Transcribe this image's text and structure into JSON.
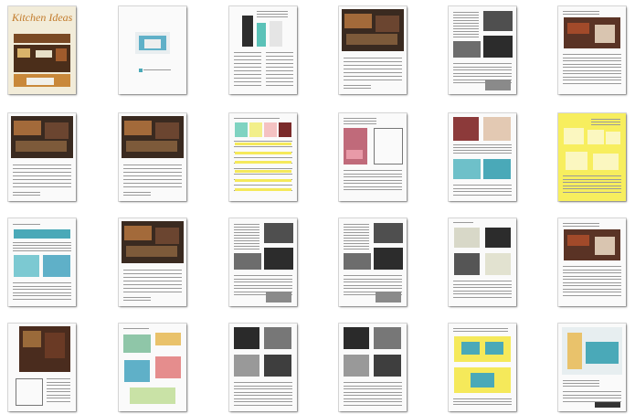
{
  "app": {
    "title": ""
  },
  "pages": [
    {
      "id": 1,
      "kind": "cover",
      "title": "Kitchen Ideas"
    },
    {
      "id": 2,
      "kind": "title-page",
      "caption": ""
    },
    {
      "id": 3,
      "kind": "ad-fridge"
    },
    {
      "id": 4,
      "kind": "photo-text"
    },
    {
      "id": 5,
      "kind": "text-photos"
    },
    {
      "id": 6,
      "kind": "text-photo"
    },
    {
      "id": 7,
      "kind": "photo-text"
    },
    {
      "id": 8,
      "kind": "photo-text"
    },
    {
      "id": 9,
      "kind": "color-chart"
    },
    {
      "id": 10,
      "kind": "photo-diagram"
    },
    {
      "id": 11,
      "kind": "photos-blue"
    },
    {
      "id": 12,
      "kind": "yellow-page"
    },
    {
      "id": 13,
      "kind": "blue-photos"
    },
    {
      "id": 14,
      "kind": "photo-text"
    },
    {
      "id": 15,
      "kind": "text-photos"
    },
    {
      "id": 16,
      "kind": "text-photos"
    },
    {
      "id": 17,
      "kind": "photos-text"
    },
    {
      "id": 18,
      "kind": "text-photo"
    },
    {
      "id": 19,
      "kind": "photo-plan"
    },
    {
      "id": 20,
      "kind": "illustrated"
    },
    {
      "id": 21,
      "kind": "photos-grid"
    },
    {
      "id": 22,
      "kind": "photos-grid"
    },
    {
      "id": 23,
      "kind": "yellow-diagram"
    },
    {
      "id": 24,
      "kind": "ad-appliance"
    }
  ],
  "colors": {
    "shadow": "#000000",
    "cover_title": "#c27a2a",
    "accent_yellow": "#f5e95a",
    "accent_teal": "#4aa9b8"
  }
}
